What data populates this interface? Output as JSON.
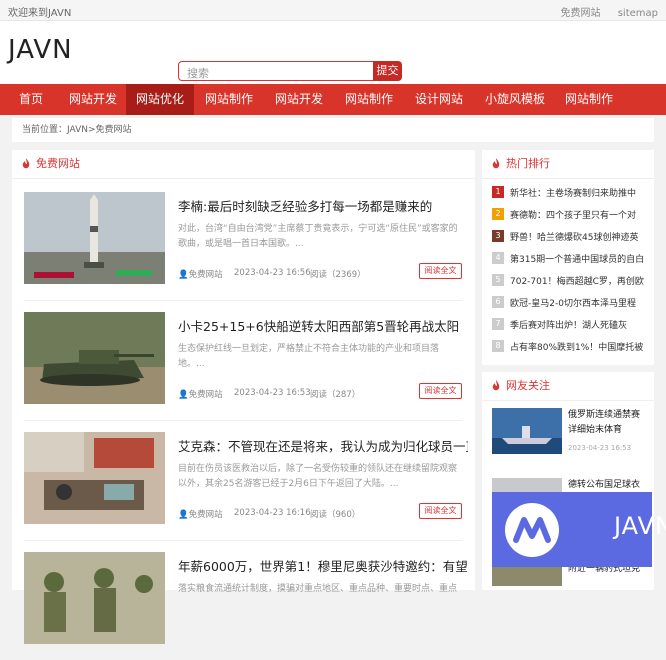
{
  "topbar": {
    "welcome": "欢迎来到JAVN",
    "links": [
      "免费网站",
      "sitemap"
    ]
  },
  "header": {
    "logo": "JAVN",
    "search_placeholder": "搜索",
    "search_button": "提交"
  },
  "nav": [
    "首页",
    "网站开发",
    "网站优化",
    "网站制作",
    "网站开发",
    "网站制作",
    "设计网站",
    "小旋风模板",
    "网站制作"
  ],
  "nav_active": 2,
  "breadcrumb": "当前位置：JAVN>免费网站",
  "main": {
    "title": "免费网站",
    "articles": [
      {
        "title": "李楠:最后时刻缺乏经验多打每一场都是赚来的",
        "summary": "对此，台湾“自由台湾党”主席蔡丁贵竟表示，宁可选“原住民”或客家的歌曲，或是唱一首日本国歌。...",
        "author": "免费网站",
        "date": "2023-04-23 16:56",
        "reads": "阅读（2369）",
        "button": "阅读全文"
      },
      {
        "title": "小卡25+15+6快船逆转太阳西部第5晋轮再战太阳",
        "summary": "生态保护红线一旦划定，严格禁止不符合主体功能的产业和项目落地。...",
        "author": "免费网站",
        "date": "2023-04-23 16:53",
        "reads": "阅读（287）",
        "button": "阅读全文"
      },
      {
        "title": "艾克森：不管现在还是将来，我认为成为归化球员一直",
        "summary": "目前在伤员该医救治以后，除了一名受伤较重的领队还在继续留院观察以外，其余25名游客已经于2月6日下午返回了大陆。...",
        "author": "免费网站",
        "date": "2023-04-23 16:16",
        "reads": "阅读（960）",
        "button": "阅读全文"
      },
      {
        "title": "年薪6000万，世界第1！穆里尼奥获沙特邀约：有望联",
        "summary": "落实粮食流通统计制度，摸骗对重点地区、重点品种、重要时点、重点",
        "author": "",
        "date": "",
        "reads": "",
        "button": ""
      }
    ]
  },
  "hot": {
    "title": "热门排行",
    "items": [
      {
        "n": "1",
        "text": "新华社：主卷场赛制归来助推中",
        "color": "#c72a25"
      },
      {
        "n": "2",
        "text": "赛德勒：四个孩子里只有一个对",
        "color": "#f0a000"
      },
      {
        "n": "3",
        "text": "野兽！哈兰德爆砍45球创神迹英",
        "color": "#7a3a2a"
      },
      {
        "n": "4",
        "text": "第315期一个普通中国球员的自白",
        "color": "#cccccc"
      },
      {
        "n": "5",
        "text": "702-701！梅西超越C罗，再创欧",
        "color": "#cccccc"
      },
      {
        "n": "6",
        "text": "欧冠-皇马2-0切尔西本泽马里程",
        "color": "#cccccc"
      },
      {
        "n": "7",
        "text": "季后赛对阵出炉！湖人死磕灰",
        "color": "#cccccc"
      },
      {
        "n": "8",
        "text": "占有率80%跌到1%！中国摩托被",
        "color": "#cccccc"
      }
    ]
  },
  "friends": {
    "title": "网友关注",
    "items": [
      {
        "text": "俄罗斯连续通禁赛详细始末体育",
        "date": "2023-04-23 16:53"
      },
      {
        "text": "德转公布国足球衣",
        "date": ""
      },
      {
        "text": "附近一辆豹式坦克",
        "date": ""
      }
    ]
  },
  "badge": {
    "label": "JAVN"
  },
  "colors": {
    "accent": "#d9342a",
    "nav_active": "#a81d17",
    "badge": "#5b6ae0"
  }
}
